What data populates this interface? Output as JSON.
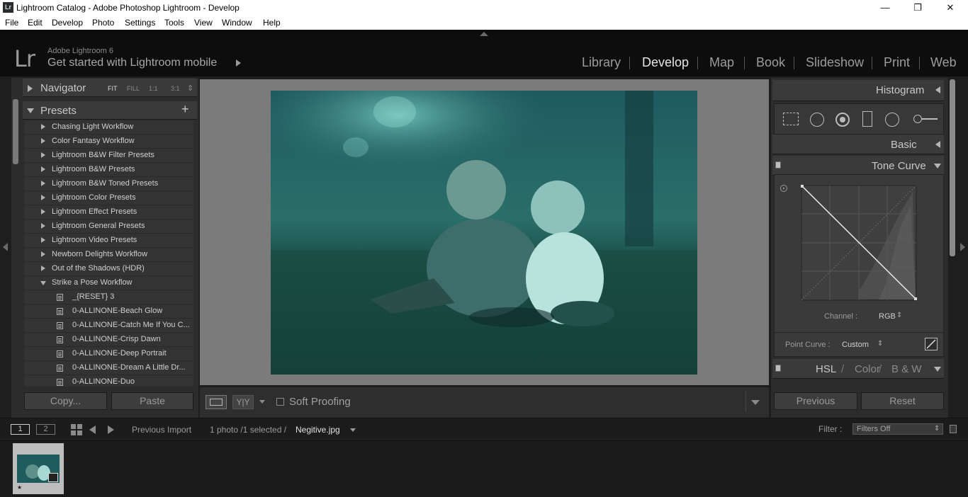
{
  "window": {
    "title": "Lightroom Catalog - Adobe Photoshop Lightroom - Develop",
    "app_icon": "Lr",
    "controls": {
      "minimize": "—",
      "maximize": "❐",
      "close": "✕"
    }
  },
  "menu": [
    "File",
    "Edit",
    "Develop",
    "Photo",
    "Settings",
    "Tools",
    "View",
    "Window",
    "Help"
  ],
  "header": {
    "logo": "Lr",
    "product": "Adobe Lightroom 6",
    "mobile_text": "Get started with Lightroom mobile",
    "modules": [
      "Library",
      "Develop",
      "Map",
      "Book",
      "Slideshow",
      "Print",
      "Web"
    ],
    "active_module": "Develop"
  },
  "left": {
    "navigator": {
      "title": "Navigator",
      "options": [
        "FIT",
        "FILL",
        "1:1",
        "3:1"
      ],
      "active": "FIT",
      "stepper": "⇕"
    },
    "presets": {
      "title": "Presets",
      "add": "+",
      "folders": [
        "Chasing Light Workflow",
        "Color Fantasy Workflow",
        "Lightroom B&W Filter Presets",
        "Lightroom B&W Presets",
        "Lightroom B&W Toned Presets",
        "Lightroom Color Presets",
        "Lightroom Effect Presets",
        "Lightroom General Presets",
        "Lightroom Video Presets",
        "Newborn Delights Workflow",
        "Out of the Shadows (HDR)"
      ],
      "open_folder": "Strike a Pose Workflow",
      "items": [
        "_{RESET} 3",
        "0-ALLINONE-Beach Glow",
        "0-ALLINONE-Catch Me If You C...",
        "0-ALLINONE-Crisp Dawn",
        "0-ALLINONE-Deep Portrait",
        "0-ALLINONE-Dream A Little Dr...",
        "0-ALLINONE-Duo"
      ]
    },
    "copy_button": "Copy...",
    "paste_button": "Paste"
  },
  "toolbar": {
    "soft_proofing": "Soft Proofing",
    "compare": "Y|Y"
  },
  "right": {
    "histogram": "Histogram",
    "basic": "Basic",
    "tone_curve": "Tone Curve",
    "channel_label": "Channel :",
    "channel_value": "RGB",
    "point_curve_label": "Point Curve :",
    "point_curve_value": "Custom",
    "hsl": {
      "hsl": "HSL",
      "slash": "/",
      "color": "Color",
      "bw": "B & W"
    },
    "previous_button": "Previous",
    "reset_button": "Reset"
  },
  "filmbar": {
    "view1": "1",
    "view2": "2",
    "source": "Previous Import",
    "count": "1 photo /1 selected /",
    "filename": "Negitive.jpg",
    "filter_label": "Filter :",
    "filter_value": "Filters Off"
  },
  "colors": {
    "active_module": "#e6e6e6",
    "inactive_module": "#9c9c9c",
    "panel": "#2c2c2c",
    "center_bg": "#7b7b7b"
  }
}
